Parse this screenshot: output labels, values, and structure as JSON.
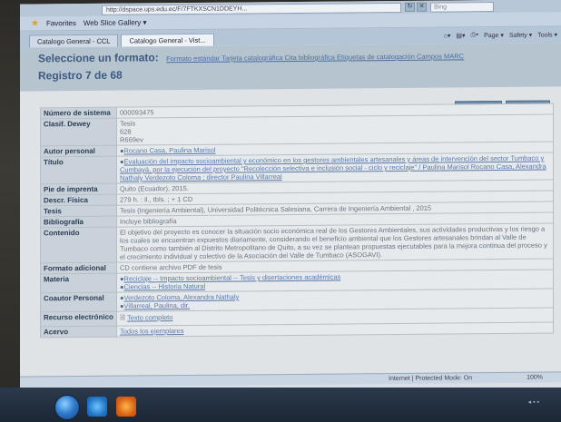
{
  "browser": {
    "url": "http://dspace.ups.edu.ec/F/7FTKXSCN1DDEYH...",
    "search_placeholder": "Bing",
    "favorites_label": "Favorites",
    "webslice_label": "Web Slice Gallery ▾",
    "tabs": [
      {
        "label": "Catalogo General - CCL"
      },
      {
        "label": "Catalogo General - Vist..."
      }
    ],
    "cmd_page": "Page ▾",
    "cmd_safety": "Safety ▾",
    "cmd_tools": "Tools ▾"
  },
  "banner": {
    "title": "Seleccione un formato:",
    "formats": "Formato estándar Tarjeta catalográfica Cita bibliográfica Etiquetas de catalogación Campos MARC",
    "registro": "Registro 7 de 68"
  },
  "nav": {
    "prev": "◂Reg. anterior",
    "next": "Sig. registro▸"
  },
  "record": [
    {
      "label": "Número de sistema",
      "value": "000093475"
    },
    {
      "label": "Clasif. Dewey",
      "lines": [
        "Tesis",
        "628",
        "R669ev"
      ]
    },
    {
      "label": "Autor personal",
      "link": "Rocano Casa, Paulina Marisol"
    },
    {
      "label": "Título",
      "link": "Evaluación del impacto socioambiental y económico en los gestores ambientales artesanales y áreas de intervención del sector Tumbaco y Cumbayá, por la ejecución del proyecto \"Recolección selectiva e inclusión social - ciclo y reciclaje\" / Paulina Marisol Rocano Casa, Alexandra Nathaly Verdezoto Coloma ; director Paulina Villarreal"
    },
    {
      "label": "Pie de imprenta",
      "value": "Quito (Ecuador), 2015."
    },
    {
      "label": "Descr. Física",
      "value": "279 h. : il., tbls. ; + 1 CD"
    },
    {
      "label": "Tesis",
      "value": "Tesis (Ingeniería Ambiental), Universidad Politécnica Salesiana, Carrera de Ingeniería Ambiental , 2015"
    },
    {
      "label": "Bibliografía",
      "value": "Incluye bibliografía"
    },
    {
      "label": "Contenido",
      "value": "El objetivo del proyecto es conocer la situación socio económica real de los Gestores Ambientales, sus actividades productivas y los riesgo a los cuales se encuentran expuestos diariamente, considerando el beneficio ambiental que los Gestores artesanales brindan al Valle de Tumbaco como también al Distrito Metropolitano de Quito, a su vez se plantean propuestas ejecutables para la mejora continua del proceso y el crecimiento individual y colectivo de la Asociación del Valle de Tumbaco (ASOGAVI)."
    },
    {
      "label": "Formato adicional",
      "value": "CD contiene archivo PDF de tesis"
    },
    {
      "label": "Materia",
      "links": [
        "Reciclaje -- Impacto socioambiental -- Tesis y disertaciones académicas",
        "Ciencias -- Historia Natural"
      ]
    },
    {
      "label": "Coautor Personal",
      "links": [
        "Verdezoto Coloma, Alexandra Nathaly",
        "Villarreal, Paulina, dir."
      ]
    },
    {
      "label": "Recurso electrónico",
      "link": "Texto completo"
    },
    {
      "label": "Acervo",
      "link": "Todos los ejemplares"
    }
  ],
  "status": {
    "zone": "Internet | Protected Mode: On",
    "zoom": "100%"
  }
}
